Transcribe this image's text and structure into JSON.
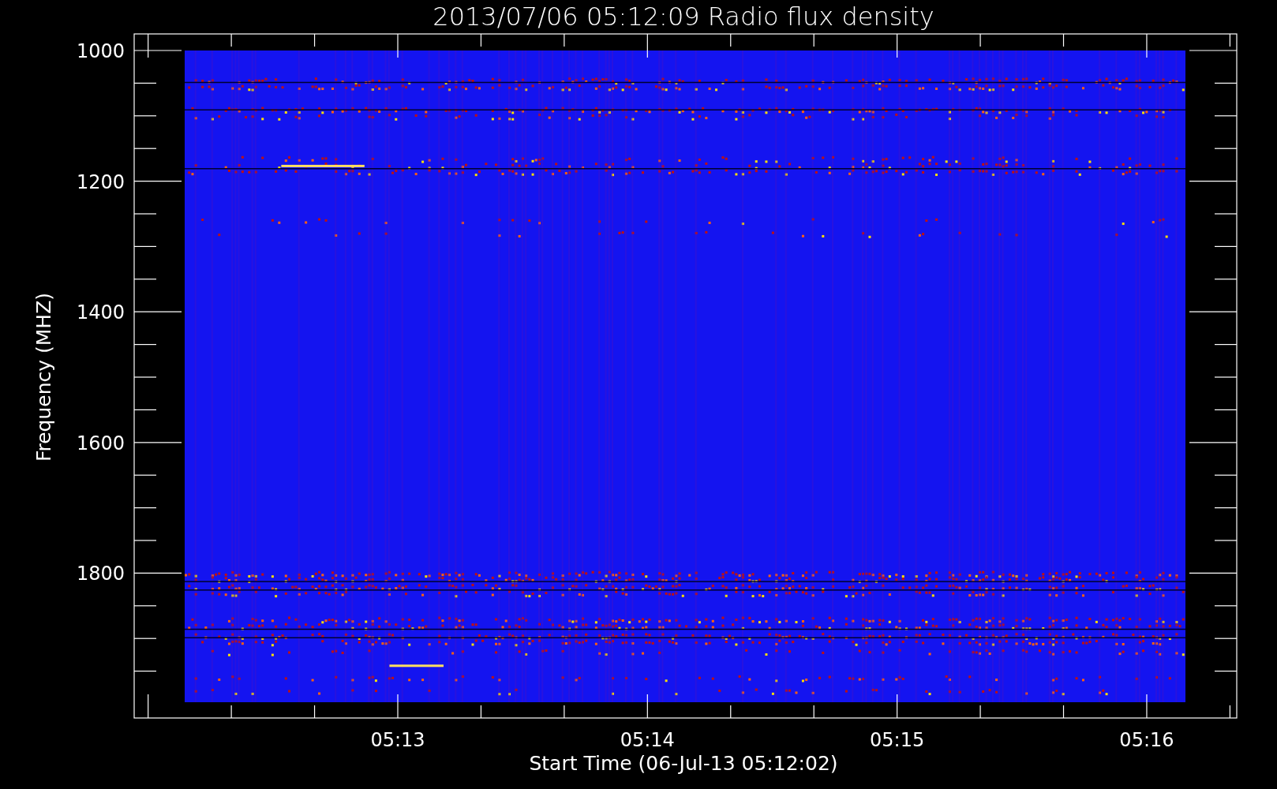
{
  "title": "2013/07/06 05:12:09 Radio flux density",
  "y_axis": {
    "label": "Frequency (MHZ)",
    "tick_labels": [
      "1000",
      "1200",
      "1400",
      "1600",
      "1800"
    ]
  },
  "x_axis": {
    "label": "Start Time (06-Jul-13 05:12:02)",
    "tick_labels": [
      "05:13",
      "05:14",
      "05:15",
      "05:16"
    ]
  }
}
